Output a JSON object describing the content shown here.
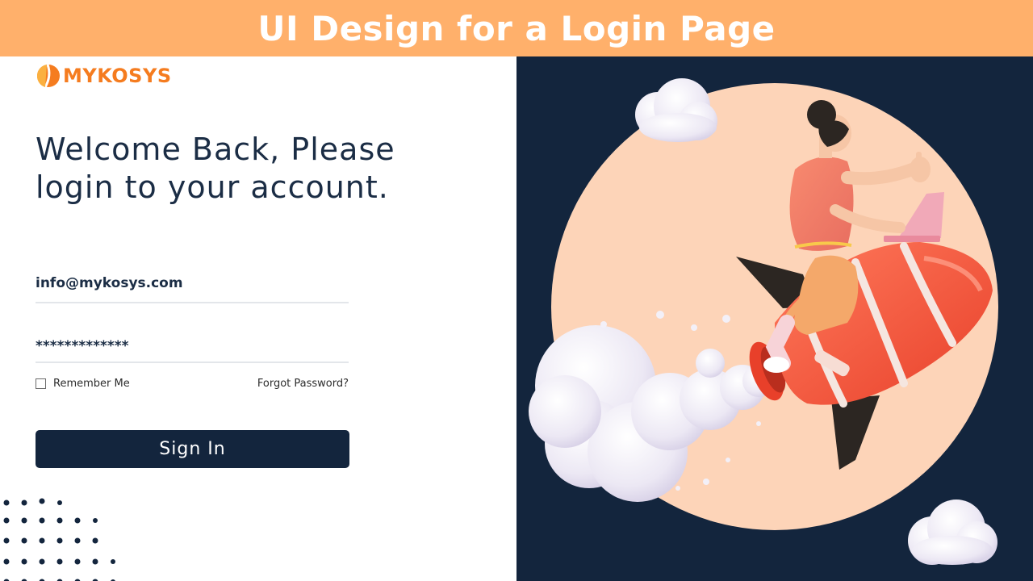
{
  "banner": {
    "title": "UI Design for a Login Page"
  },
  "brand": {
    "name": "MYKOSYS",
    "accent": "#f57c1f"
  },
  "login": {
    "headline_line1": "Welcome Back, Please",
    "headline_line2": "login to your account.",
    "email_value": "info@mykosys.com",
    "password_value": "*************",
    "remember_label": "Remember Me",
    "remember_checked": false,
    "forgot_label": "Forgot Password?",
    "signin_label": "Sign In"
  },
  "colors": {
    "banner_bg": "#ffb06b",
    "navy": "#13253d",
    "peach_circle": "#fdd4b8",
    "rocket": "#f1553a"
  },
  "icons": {
    "logo": "mykosys-logo-icon",
    "checkbox": "checkbox-icon"
  }
}
